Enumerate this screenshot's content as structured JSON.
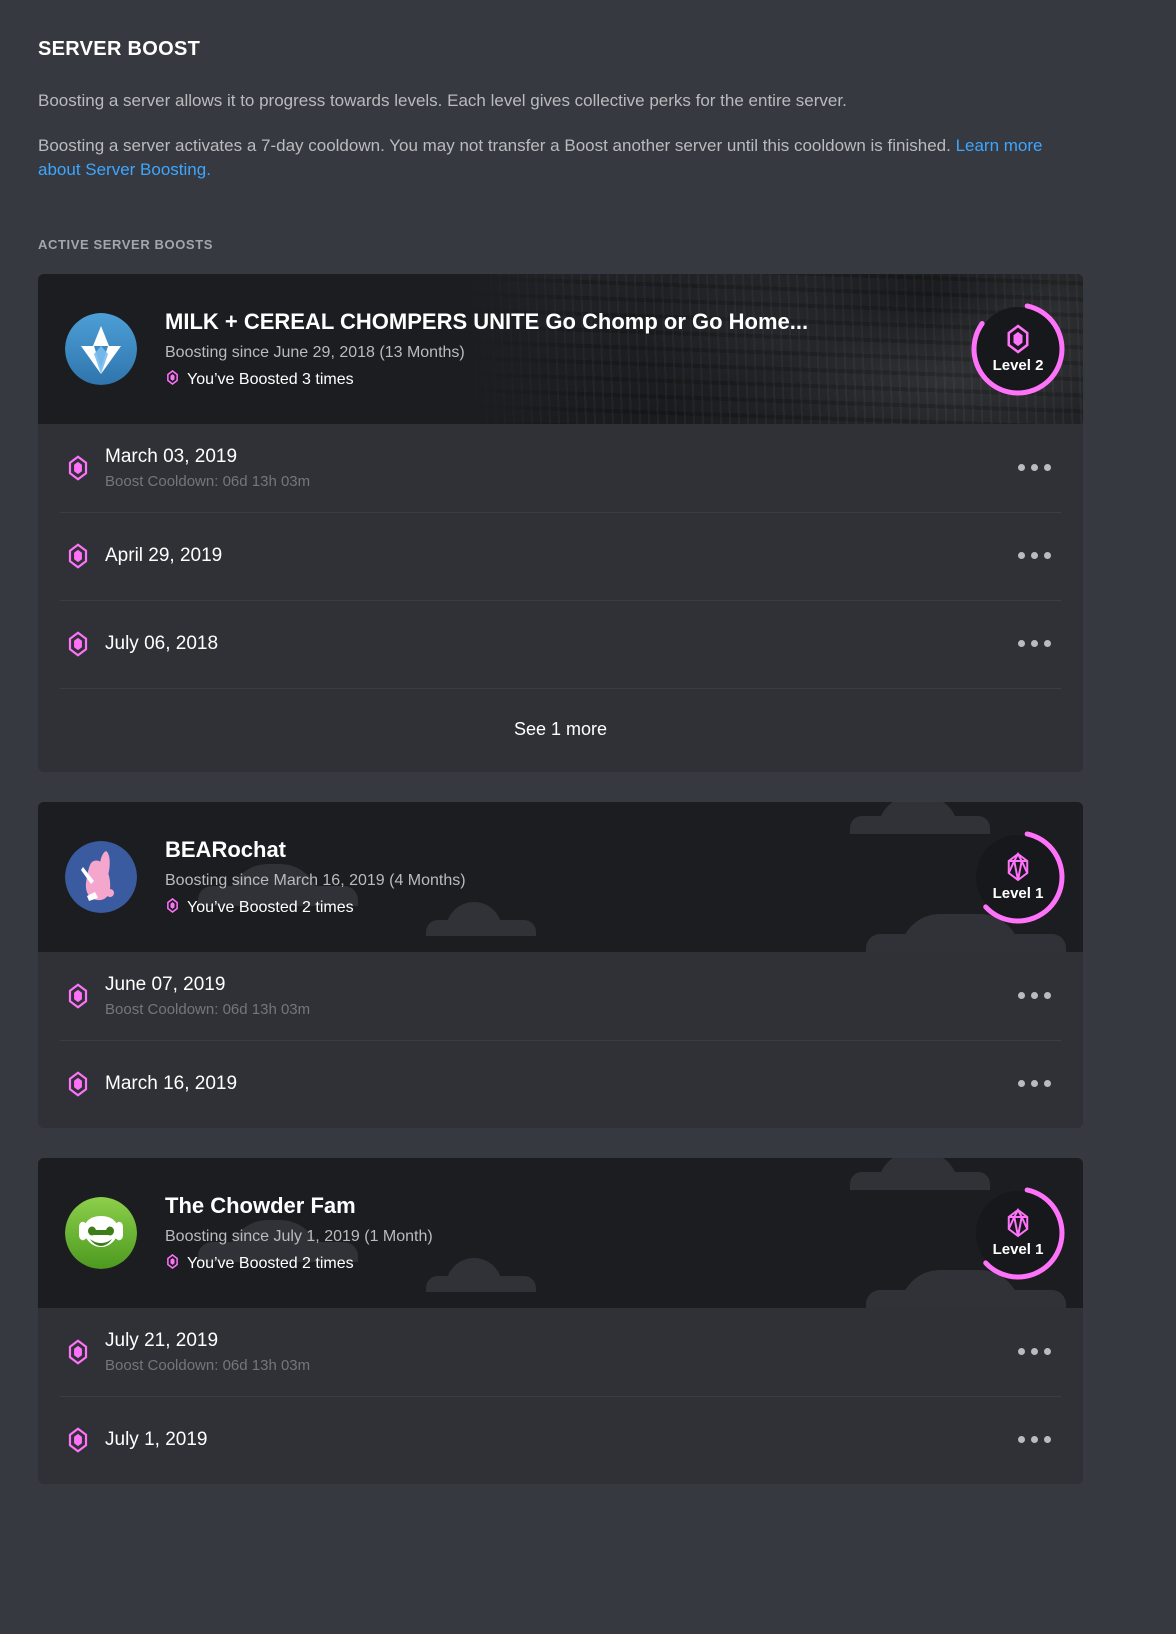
{
  "header": {
    "title": "SERVER BOOST",
    "paragraph1": "Boosting a server allows it to progress towards levels. Each level gives collective perks for the entire server.",
    "paragraph2_before": "Boosting a server activates a 7-day cooldown. You may not transfer a Boost another server until this cooldown is finished. ",
    "learn_more_link": "Learn more about Server Boosting."
  },
  "section": {
    "label": "ACTIVE SERVER BOOSTS"
  },
  "colors": {
    "accent_pink": "#ff73fa",
    "link_blue": "#3ea6ff",
    "page_background": "#36393f",
    "card_body": "#2f3136",
    "card_header": "#1c1d21"
  },
  "servers": [
    {
      "name": "MILK + CEREAL CHOMPERS UNITE Go Chomp or Go Home...",
      "boosting_since": "Boosting since June 29, 2018 (13 Months)",
      "boost_count": "You’ve Boosted 3 times",
      "level": "Level 2",
      "level_number": 2,
      "avatar_icon": "vector-diamond-avatar",
      "banner_type": "photo",
      "boosts": [
        {
          "date": "March 03, 2019",
          "cooldown": "Boost Cooldown: 06d 13h 03m"
        },
        {
          "date": "April 29, 2019",
          "cooldown": ""
        },
        {
          "date": "July 06, 2018",
          "cooldown": ""
        }
      ],
      "see_more_label": "See 1 more"
    },
    {
      "name": "BEARochat",
      "boosting_since": "Boosting since March 16, 2019 (4 Months)",
      "boost_count": "You’ve Boosted 2 times",
      "level": "Level 1",
      "level_number": 1,
      "avatar_icon": "bunny-avatar",
      "banner_type": "clouds",
      "boosts": [
        {
          "date": "June 07, 2019",
          "cooldown": "Boost Cooldown: 06d 13h 03m"
        },
        {
          "date": "March 16, 2019",
          "cooldown": ""
        }
      ],
      "see_more_label": ""
    },
    {
      "name": "The Chowder Fam",
      "boosting_since": "Boosting since July 1, 2019 (1 Month)",
      "boost_count": "You’ve Boosted 2 times",
      "level": "Level 1",
      "level_number": 1,
      "avatar_icon": "frog-headphones-avatar",
      "banner_type": "clouds",
      "boosts": [
        {
          "date": "July 21, 2019",
          "cooldown": "Boost Cooldown: 06d 13h 03m"
        },
        {
          "date": "July 1, 2019",
          "cooldown": ""
        }
      ],
      "see_more_label": ""
    }
  ]
}
